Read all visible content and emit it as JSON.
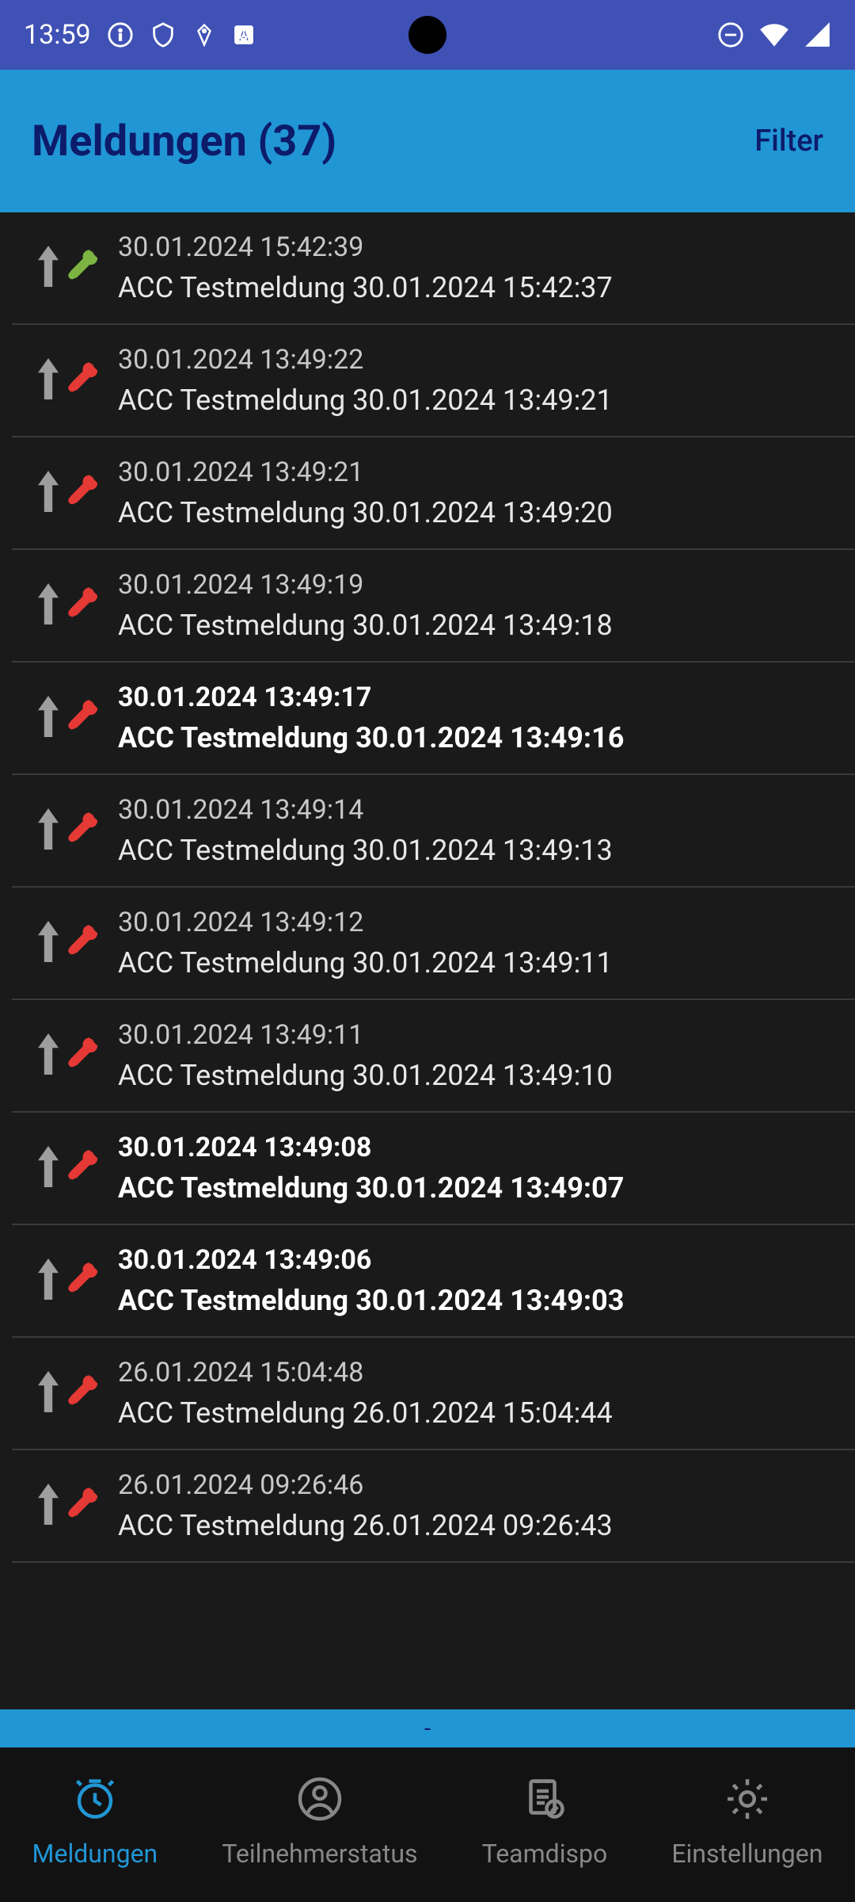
{
  "statusbar": {
    "time": "13:59"
  },
  "header": {
    "title": "Meldungen (37)",
    "filter_label": "Filter"
  },
  "footer_text": "-",
  "items": [
    {
      "timestamp": "30.01.2024 15:42:39",
      "title": "ACC Testmeldung 30.01.2024 15:42:37",
      "wrench": "green",
      "bold": false
    },
    {
      "timestamp": "30.01.2024 13:49:22",
      "title": "ACC Testmeldung 30.01.2024 13:49:21",
      "wrench": "red",
      "bold": false
    },
    {
      "timestamp": "30.01.2024 13:49:21",
      "title": "ACC Testmeldung 30.01.2024 13:49:20",
      "wrench": "red",
      "bold": false
    },
    {
      "timestamp": "30.01.2024 13:49:19",
      "title": "ACC Testmeldung 30.01.2024 13:49:18",
      "wrench": "red",
      "bold": false
    },
    {
      "timestamp": "30.01.2024 13:49:17",
      "title": "ACC Testmeldung 30.01.2024 13:49:16",
      "wrench": "red",
      "bold": true
    },
    {
      "timestamp": "30.01.2024 13:49:14",
      "title": "ACC Testmeldung 30.01.2024 13:49:13",
      "wrench": "red",
      "bold": false
    },
    {
      "timestamp": "30.01.2024 13:49:12",
      "title": "ACC Testmeldung 30.01.2024 13:49:11",
      "wrench": "red",
      "bold": false
    },
    {
      "timestamp": "30.01.2024 13:49:11",
      "title": "ACC Testmeldung 30.01.2024 13:49:10",
      "wrench": "red",
      "bold": false
    },
    {
      "timestamp": "30.01.2024 13:49:08",
      "title": "ACC Testmeldung 30.01.2024 13:49:07",
      "wrench": "red",
      "bold": true
    },
    {
      "timestamp": "30.01.2024 13:49:06",
      "title": "ACC Testmeldung 30.01.2024 13:49:03",
      "wrench": "red",
      "bold": true
    },
    {
      "timestamp": "26.01.2024 15:04:48",
      "title": "ACC Testmeldung 26.01.2024 15:04:44",
      "wrench": "red",
      "bold": false
    },
    {
      "timestamp": "26.01.2024 09:26:46",
      "title": "ACC Testmeldung 26.01.2024 09:26:43",
      "wrench": "red",
      "bold": false
    }
  ],
  "nav": {
    "items": [
      {
        "label": "Meldungen",
        "active": true
      },
      {
        "label": "Teilnehmerstatus",
        "active": false
      },
      {
        "label": "Teamdispo",
        "active": false
      },
      {
        "label": "Einstellungen",
        "active": false
      }
    ]
  }
}
